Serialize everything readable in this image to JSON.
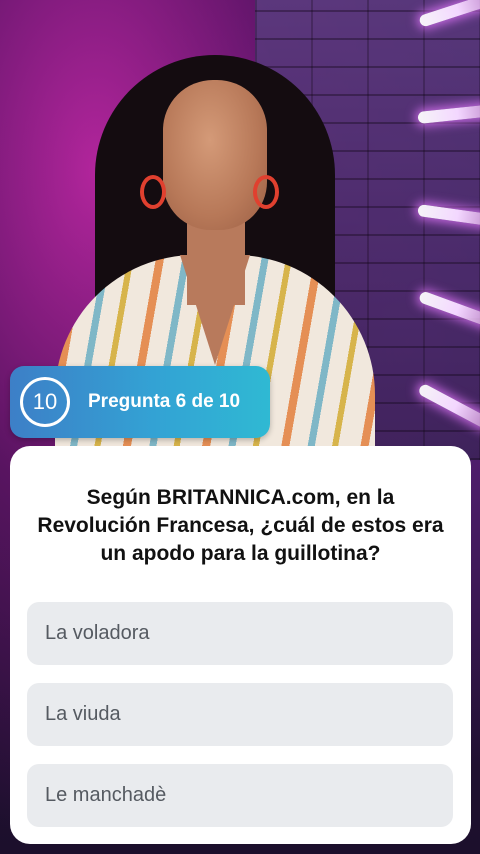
{
  "counter": {
    "timer": "10",
    "label": "Pregunta 6 de 10",
    "gradient_start": "#3d7fc7",
    "gradient_end": "#2fb9d3"
  },
  "question": {
    "text": "Según BRITANNICA.com, en la Revolución Francesa, ¿cuál de estos era un apodo para la guillotina?"
  },
  "answers": [
    {
      "label": "La voladora"
    },
    {
      "label": "La viuda"
    },
    {
      "label": "Le manchadè"
    }
  ],
  "colors": {
    "card_background": "#ffffff",
    "answer_background": "#e9ebee",
    "answer_text": "#555a61"
  }
}
